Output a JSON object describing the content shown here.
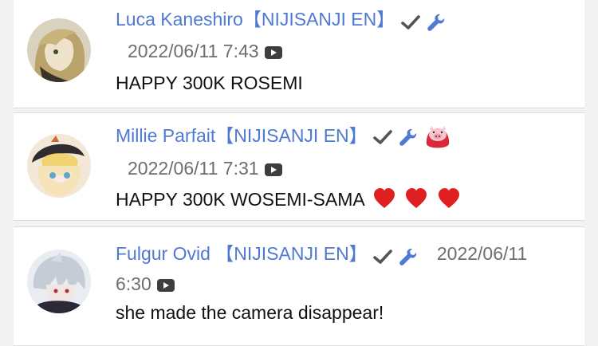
{
  "comments": [
    {
      "author": "Luca Kaneshiro【NIJISANJI EN】",
      "timestamp": "2022/06/11 7:43",
      "message": "HAPPY 300K ROSEMI",
      "badges": [
        "verified-check-icon",
        "moderator-wrench-icon"
      ],
      "avatar_icon": "luca-avatar"
    },
    {
      "author": "Millie Parfait【NIJISANJI EN】",
      "timestamp": "2022/06/11 7:31",
      "message": "HAPPY 300K WOSEMI-SAMA",
      "message_emoji": [
        "❤️",
        "❤️",
        "❤️"
      ],
      "badges": [
        "verified-check-icon",
        "moderator-wrench-icon",
        "pig-member-badge-icon"
      ],
      "avatar_icon": "millie-avatar"
    },
    {
      "author": "Fulgur Ovid",
      "author_tag": "【NIJISANJI EN】",
      "timestamp_date": "2022/06/11",
      "timestamp_time": "6:30",
      "message": "she made the camera disappear!",
      "badges": [
        "verified-check-icon",
        "moderator-wrench-icon"
      ],
      "avatar_icon": "fulgur-avatar"
    }
  ],
  "colors": {
    "author": "#4f79d2",
    "timestamp": "#6e6e6e",
    "message": "#111111",
    "check": "#555555",
    "wrench": "#4f79d2",
    "heart": "#e02020",
    "background": "#f2f2f2",
    "card": "#ffffff"
  }
}
